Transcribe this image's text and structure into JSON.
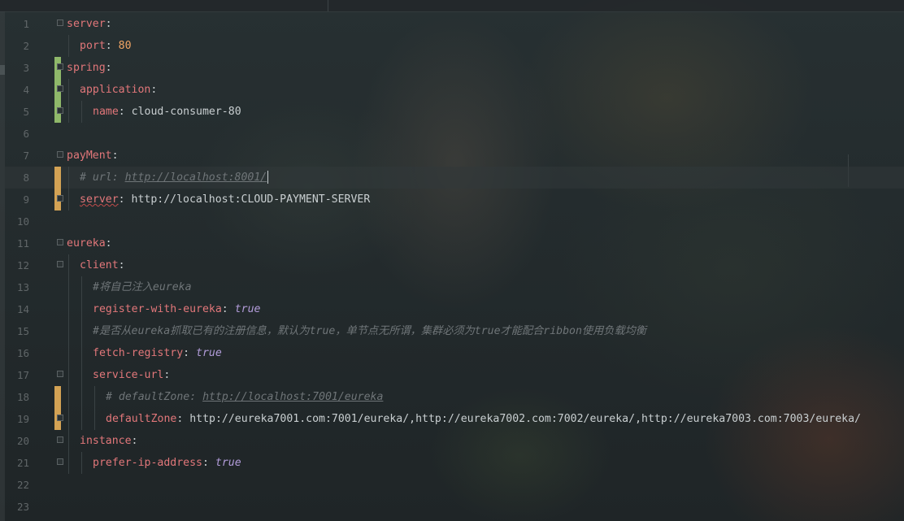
{
  "editor": {
    "lines": [
      {
        "n": "1",
        "key": "server",
        "sep": ":",
        "value": "",
        "vtype": "",
        "indent": 0,
        "change": "",
        "fold": true
      },
      {
        "n": "2",
        "key": "port",
        "sep": ": ",
        "value": "80",
        "vtype": "num",
        "indent": 1,
        "change": "",
        "fold": false
      },
      {
        "n": "3",
        "key": "spring",
        "sep": ":",
        "value": "",
        "vtype": "",
        "indent": 0,
        "change": "added",
        "fold": true
      },
      {
        "n": "4",
        "key": "application",
        "sep": ":",
        "value": "",
        "vtype": "",
        "indent": 1,
        "change": "added",
        "fold": true
      },
      {
        "n": "5",
        "key": "name",
        "sep": ": ",
        "value": "cloud-consumer-80",
        "vtype": "str",
        "indent": 2,
        "change": "added",
        "fold": true
      },
      {
        "n": "6",
        "key": "",
        "sep": "",
        "value": "",
        "vtype": "",
        "indent": 0,
        "change": "",
        "fold": false
      },
      {
        "n": "7",
        "key": "payMent",
        "sep": ":",
        "value": "",
        "vtype": "",
        "indent": 0,
        "change": "",
        "fold": true
      },
      {
        "n": "8",
        "comment": "# url: ",
        "comment_url": "http://localhost:8001/",
        "indent": 1,
        "change": "modified",
        "fold": false,
        "current": true
      },
      {
        "n": "9",
        "key": "server",
        "sep": ": ",
        "value": "http://localhost:CLOUD-PAYMENT-SERVER",
        "vtype": "str",
        "indent": 1,
        "change": "modified",
        "fold": true,
        "squiggle": true
      },
      {
        "n": "10",
        "key": "",
        "sep": "",
        "value": "",
        "vtype": "",
        "indent": 0,
        "change": "",
        "fold": false
      },
      {
        "n": "11",
        "key": "eureka",
        "sep": ":",
        "value": "",
        "vtype": "",
        "indent": 0,
        "change": "",
        "fold": true
      },
      {
        "n": "12",
        "key": "client",
        "sep": ":",
        "value": "",
        "vtype": "",
        "indent": 1,
        "change": "",
        "fold": true
      },
      {
        "n": "13",
        "comment": "#将自己注入eureka",
        "comment_url": "",
        "indent": 2,
        "change": "",
        "fold": false
      },
      {
        "n": "14",
        "key": "register-with-eureka",
        "sep": ": ",
        "value": "true",
        "vtype": "bool",
        "indent": 2,
        "change": "",
        "fold": false
      },
      {
        "n": "15",
        "comment": "#是否从eureka抓取已有的注册信息，默认为true，单节点无所谓，集群必须为true才能配合ribbon使用负载均衡",
        "comment_url": "",
        "indent": 2,
        "change": "",
        "fold": false
      },
      {
        "n": "16",
        "key": "fetch-registry",
        "sep": ": ",
        "value": "true",
        "vtype": "bool",
        "indent": 2,
        "change": "",
        "fold": false
      },
      {
        "n": "17",
        "key": "service-url",
        "sep": ":",
        "value": "",
        "vtype": "",
        "indent": 2,
        "change": "",
        "fold": true
      },
      {
        "n": "18",
        "comment": "# defaultZone: ",
        "comment_url": "http://localhost:7001/eureka",
        "indent": 3,
        "change": "modified",
        "fold": false
      },
      {
        "n": "19",
        "key": "defaultZone",
        "sep": ": ",
        "value": "http://eureka7001.com:7001/eureka/,http://eureka7002.com:7002/eureka/,http://eureka7003.com:7003/eureka/",
        "vtype": "str",
        "indent": 3,
        "change": "modified",
        "fold": true
      },
      {
        "n": "20",
        "key": "instance",
        "sep": ":",
        "value": "",
        "vtype": "",
        "indent": 1,
        "change": "",
        "fold": true
      },
      {
        "n": "21",
        "key": "prefer-ip-address",
        "sep": ": ",
        "value": "true",
        "vtype": "bool",
        "indent": 2,
        "change": "",
        "fold": true
      },
      {
        "n": "22",
        "key": "",
        "sep": "",
        "value": "",
        "vtype": "",
        "indent": 0,
        "change": "",
        "fold": false
      },
      {
        "n": "23",
        "key": "",
        "sep": "",
        "value": "",
        "vtype": "",
        "indent": 0,
        "change": "",
        "fold": false
      }
    ]
  },
  "colors": {
    "key": "#e2777a",
    "number": "#f0a464",
    "boolean": "#b39ddb",
    "comment": "#6f7578",
    "modified_marker": "#d3a254",
    "added_marker": "#8fb86a"
  }
}
